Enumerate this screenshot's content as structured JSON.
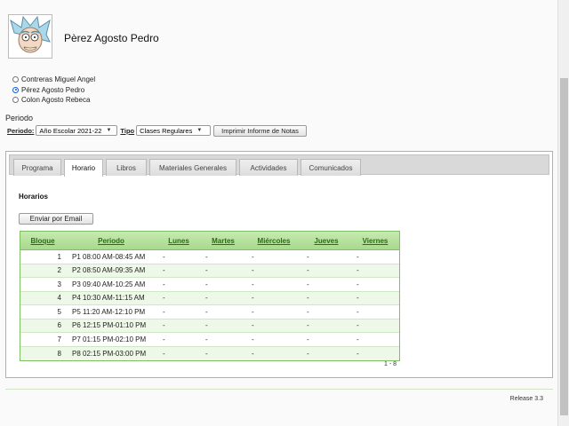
{
  "header": {
    "student_name": "Pèrez Agosto Pedro",
    "avatar_icon": "rick-avatar-icon"
  },
  "students": [
    {
      "label": "Contreras Miguel Angel",
      "selected": false
    },
    {
      "label": "Pérez Agosto Pedro",
      "selected": true
    },
    {
      "label": "Colon Agosto Rebeca",
      "selected": false
    }
  ],
  "filters": {
    "section_title": "Periodo",
    "periodo_label": "Periodo:",
    "periodo_value": "Año Escolar 2021-22",
    "tipo_label": "Tipo",
    "tipo_value": "Clases Regulares",
    "print_button": "Imprimir Informe de Notas"
  },
  "tabs": [
    {
      "label": "Programa",
      "active": false
    },
    {
      "label": "Horario",
      "active": true
    },
    {
      "label": "Libros",
      "active": false
    },
    {
      "label": "Materiales Generales",
      "active": false
    },
    {
      "label": "Actividades",
      "active": false
    },
    {
      "label": "Comunicados",
      "active": false
    }
  ],
  "schedule": {
    "title": "Horarios",
    "email_button": "Enviar por Email",
    "columns": [
      "Bloque",
      "Periodo",
      "Lunes",
      "Martes",
      "Miércoles",
      "Jueves",
      "Viernes"
    ],
    "rows": [
      [
        "1",
        "P1 08:00 AM-08:45 AM",
        "-",
        "-",
        "-",
        "-",
        "-"
      ],
      [
        "2",
        "P2 08:50 AM-09:35 AM",
        "-",
        "-",
        "-",
        "-",
        "-"
      ],
      [
        "3",
        "P3 09:40 AM-10:25 AM",
        "-",
        "-",
        "-",
        "-",
        "-"
      ],
      [
        "4",
        "P4 10:30 AM-11:15 AM",
        "-",
        "-",
        "-",
        "-",
        "-"
      ],
      [
        "5",
        "P5 11:20 AM-12:10 PM",
        "-",
        "-",
        "-",
        "-",
        "-"
      ],
      [
        "6",
        "P6 12:15 PM-01:10 PM",
        "-",
        "-",
        "-",
        "-",
        "-"
      ],
      [
        "7",
        "P7 01:15 PM-02:10 PM",
        "-",
        "-",
        "-",
        "-",
        "-"
      ],
      [
        "8",
        "P8 02:15 PM-03:00 PM",
        "-",
        "-",
        "-",
        "-",
        "-"
      ]
    ],
    "pager": "1 - 8"
  },
  "footer": {
    "release": "Release 3.3"
  }
}
